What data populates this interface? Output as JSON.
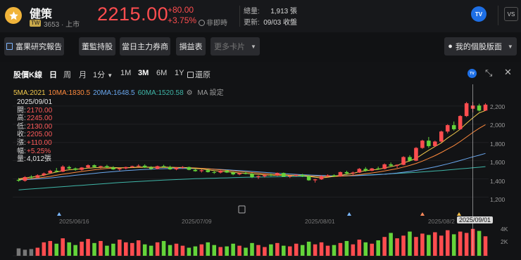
{
  "header": {
    "name": "健策",
    "market_tag": "TW",
    "code": "3653 · 上市",
    "price": "2215.00",
    "change": "+80.00",
    "change_pct": "+3.75%",
    "status": "非即時",
    "volume_label": "總量:",
    "volume_value": "1,913 張",
    "updated_label": "更新:",
    "updated_value": "09/03 收盤",
    "tv_label": "TV",
    "vs_label": "VS"
  },
  "toolbar": {
    "research": "富果研究報告",
    "directors": "董監持股",
    "brokers": "當日主力券商",
    "financials": "損益表",
    "more_cards": "更多卡片",
    "layout": "我的個股版面"
  },
  "chart_controls": {
    "title": "股價K線",
    "periods": [
      "日",
      "周",
      "月",
      "1分"
    ],
    "ranges": [
      "1M",
      "3M",
      "6M",
      "1Y"
    ],
    "active_range": "3M",
    "restore": "還原"
  },
  "ma_legend": {
    "ma5": "5MA:2021",
    "ma10": "10MA:1830.5",
    "ma20": "20MA:1648.5",
    "ma60": "60MA:1520.58",
    "settings": "MA 設定"
  },
  "ohlc": {
    "date": "2025/09/01",
    "open_label": "開:",
    "open": "2170.00",
    "high_label": "高:",
    "high": "2245.00",
    "low_label": "低:",
    "low": "2130.00",
    "close_label": "收:",
    "close": "2205.00",
    "chg_label": "漲:",
    "chg": "+110.00",
    "pct_label": "幅:",
    "pct": "+5.25%",
    "vol_label": "量:",
    "vol": "4,012張"
  },
  "colors": {
    "up": "#ff4d4f",
    "down": "#64d43a",
    "ma5": "#f2c94c",
    "ma10": "#ff8a3d",
    "ma20": "#6aa8f0",
    "ma60": "#3fb6a8"
  },
  "chart_data": {
    "type": "candlestick",
    "y_ticks": [
      "2,200",
      "2,000",
      "1,800",
      "1,600",
      "1,400",
      "1,200"
    ],
    "y_tick_values": [
      2200,
      2000,
      1800,
      1600,
      1400,
      1200
    ],
    "x_ticks": [
      "2025/06/16",
      "2025/07/09",
      "2025/08/01",
      "2025/08/2"
    ],
    "crosshair_date": "2025/09/01",
    "volume_ticks": [
      "4K",
      "2K"
    ],
    "ylim": [
      1050,
      2330
    ],
    "candles": [
      [
        1390,
        1410,
        1370,
        1380
      ],
      [
        1380,
        1430,
        1370,
        1420
      ],
      [
        1425,
        1440,
        1400,
        1415
      ],
      [
        1415,
        1450,
        1410,
        1440
      ],
      [
        1440,
        1470,
        1430,
        1460
      ],
      [
        1465,
        1500,
        1455,
        1490
      ],
      [
        1490,
        1520,
        1470,
        1480
      ],
      [
        1480,
        1550,
        1475,
        1535
      ],
      [
        1530,
        1545,
        1505,
        1515
      ],
      [
        1515,
        1525,
        1490,
        1500
      ],
      [
        1500,
        1530,
        1490,
        1525
      ],
      [
        1525,
        1560,
        1515,
        1550
      ],
      [
        1550,
        1560,
        1520,
        1530
      ],
      [
        1530,
        1545,
        1515,
        1540
      ],
      [
        1540,
        1555,
        1520,
        1525
      ],
      [
        1525,
        1540,
        1500,
        1505
      ],
      [
        1505,
        1520,
        1490,
        1515
      ],
      [
        1515,
        1535,
        1505,
        1530
      ],
      [
        1530,
        1545,
        1520,
        1540
      ],
      [
        1540,
        1560,
        1530,
        1545
      ],
      [
        1545,
        1560,
        1520,
        1525
      ],
      [
        1525,
        1540,
        1500,
        1510
      ],
      [
        1510,
        1545,
        1505,
        1540
      ],
      [
        1540,
        1555,
        1525,
        1530
      ],
      [
        1530,
        1545,
        1500,
        1505
      ],
      [
        1505,
        1530,
        1495,
        1525
      ],
      [
        1525,
        1540,
        1510,
        1530
      ],
      [
        1530,
        1535,
        1495,
        1500
      ],
      [
        1500,
        1515,
        1480,
        1485
      ],
      [
        1485,
        1505,
        1470,
        1495
      ],
      [
        1495,
        1510,
        1470,
        1475
      ],
      [
        1475,
        1490,
        1455,
        1470
      ],
      [
        1470,
        1495,
        1460,
        1490
      ],
      [
        1490,
        1500,
        1465,
        1470
      ],
      [
        1470,
        1480,
        1440,
        1450
      ],
      [
        1450,
        1470,
        1440,
        1465
      ],
      [
        1465,
        1480,
        1450,
        1455
      ],
      [
        1455,
        1465,
        1410,
        1420
      ],
      [
        1420,
        1440,
        1400,
        1430
      ],
      [
        1430,
        1450,
        1415,
        1445
      ],
      [
        1445,
        1460,
        1430,
        1440
      ],
      [
        1440,
        1470,
        1430,
        1465
      ],
      [
        1465,
        1470,
        1420,
        1425
      ],
      [
        1425,
        1440,
        1410,
        1435
      ],
      [
        1435,
        1450,
        1425,
        1445
      ],
      [
        1445,
        1455,
        1420,
        1430
      ],
      [
        1430,
        1440,
        1380,
        1385
      ],
      [
        1385,
        1400,
        1360,
        1395
      ],
      [
        1395,
        1440,
        1390,
        1430
      ],
      [
        1430,
        1450,
        1420,
        1440
      ],
      [
        1440,
        1450,
        1420,
        1430
      ],
      [
        1430,
        1480,
        1425,
        1475
      ],
      [
        1475,
        1490,
        1450,
        1460
      ],
      [
        1460,
        1480,
        1440,
        1470
      ],
      [
        1470,
        1520,
        1465,
        1510
      ],
      [
        1510,
        1530,
        1480,
        1490
      ],
      [
        1490,
        1520,
        1485,
        1515
      ],
      [
        1515,
        1535,
        1500,
        1510
      ],
      [
        1510,
        1570,
        1505,
        1560
      ],
      [
        1560,
        1580,
        1535,
        1545
      ],
      [
        1545,
        1560,
        1520,
        1555
      ],
      [
        1555,
        1650,
        1550,
        1640
      ],
      [
        1640,
        1660,
        1590,
        1600
      ],
      [
        1600,
        1750,
        1595,
        1740
      ],
      [
        1740,
        1830,
        1730,
        1820
      ],
      [
        1820,
        1860,
        1740,
        1760
      ],
      [
        1760,
        1820,
        1755,
        1810
      ],
      [
        1810,
        1930,
        1800,
        1920
      ],
      [
        1920,
        2000,
        1900,
        1990
      ],
      [
        1990,
        2030,
        1930,
        1945
      ],
      [
        1945,
        2100,
        1940,
        2090
      ],
      [
        2090,
        2245,
        2080,
        2230
      ],
      [
        2170,
        2245,
        2130,
        2205
      ],
      [
        2205,
        2225,
        2140,
        2150
      ],
      [
        2150,
        2230,
        2145,
        2215
      ]
    ],
    "volumes": [
      1.1,
      0.9,
      1.0,
      1.2,
      2.0,
      2.2,
      1.8,
      2.6,
      2.0,
      1.6,
      2.1,
      2.5,
      1.9,
      2.2,
      1.5,
      1.8,
      2.4,
      2.0,
      1.9,
      2.3,
      1.7,
      1.5,
      2.0,
      2.2,
      1.6,
      1.8,
      1.5,
      1.2,
      1.4,
      1.7,
      2.0,
      1.6,
      1.3,
      1.4,
      1.8,
      1.5,
      1.2,
      1.9,
      1.6,
      1.3,
      1.7,
      1.9,
      1.5,
      1.4,
      1.8,
      1.6,
      2.1,
      1.7,
      2.0,
      1.5,
      1.6,
      1.9,
      2.2,
      1.7,
      2.4,
      2.0,
      1.8,
      2.3,
      2.8,
      3.4,
      2.6,
      3.0,
      3.6,
      2.8,
      3.3,
      3.1,
      3.5,
      3.0,
      3.8,
      3.2,
      3.6,
      3.4,
      4.0,
      3.7,
      2.9
    ],
    "ma5": [
      1400,
      1410,
      1420,
      1430,
      1440,
      1460,
      1475,
      1490,
      1500,
      1505,
      1510,
      1518,
      1522,
      1526,
      1528,
      1525,
      1522,
      1522,
      1525,
      1530,
      1530,
      1528,
      1527,
      1530,
      1528,
      1525,
      1525,
      1522,
      1515,
      1510,
      1500,
      1490,
      1485,
      1480,
      1472,
      1466,
      1462,
      1455,
      1450,
      1445,
      1440,
      1440,
      1440,
      1438,
      1438,
      1438,
      1428,
      1418,
      1412,
      1418,
      1428,
      1440,
      1450,
      1462,
      1478,
      1490,
      1498,
      1505,
      1520,
      1535,
      1548,
      1575,
      1598,
      1625,
      1670,
      1715,
      1755,
      1795,
      1850,
      1895,
      1945,
      2010,
      2070,
      2125,
      2150
    ],
    "ma10": [
      1395,
      1400,
      1405,
      1410,
      1418,
      1428,
      1440,
      1452,
      1462,
      1472,
      1482,
      1492,
      1500,
      1508,
      1514,
      1518,
      1520,
      1522,
      1524,
      1526,
      1527,
      1527,
      1526,
      1526,
      1526,
      1525,
      1524,
      1523,
      1520,
      1516,
      1512,
      1506,
      1500,
      1494,
      1488,
      1482,
      1476,
      1470,
      1464,
      1458,
      1452,
      1448,
      1445,
      1442,
      1440,
      1438,
      1434,
      1430,
      1427,
      1426,
      1427,
      1430,
      1434,
      1440,
      1447,
      1456,
      1466,
      1476,
      1487,
      1500,
      1513,
      1530,
      1548,
      1570,
      1595,
      1625,
      1655,
      1690,
      1728,
      1765,
      1810,
      1860,
      1910,
      1955,
      1995
    ],
    "ma20": [
      1390,
      1393,
      1396,
      1400,
      1405,
      1411,
      1418,
      1425,
      1432,
      1440,
      1447,
      1454,
      1461,
      1468,
      1474,
      1480,
      1486,
      1491,
      1496,
      1500,
      1504,
      1507,
      1510,
      1512,
      1514,
      1515,
      1515,
      1515,
      1514,
      1512,
      1510,
      1507,
      1504,
      1500,
      1496,
      1492,
      1487,
      1482,
      1477,
      1472,
      1467,
      1462,
      1458,
      1454,
      1450,
      1446,
      1443,
      1440,
      1437,
      1435,
      1433,
      1433,
      1434,
      1435,
      1437,
      1440,
      1443,
      1447,
      1452,
      1458,
      1465,
      1473,
      1482,
      1493,
      1505,
      1518,
      1532,
      1548,
      1565,
      1583,
      1602,
      1622,
      1642,
      1660,
      1680
    ],
    "ma60": [
      1280,
      1285,
      1290,
      1295,
      1300,
      1305,
      1310,
      1315,
      1320,
      1325,
      1330,
      1335,
      1340,
      1345,
      1350,
      1355,
      1360,
      1364,
      1368,
      1372,
      1376,
      1380,
      1384,
      1387,
      1390,
      1393,
      1396,
      1399,
      1402,
      1404,
      1406,
      1408,
      1410,
      1412,
      1414,
      1416,
      1418,
      1419,
      1420,
      1421,
      1422,
      1423,
      1424,
      1425,
      1426,
      1427,
      1428,
      1429,
      1430,
      1431,
      1432,
      1434,
      1436,
      1438,
      1440,
      1443,
      1446,
      1449,
      1452,
      1456,
      1460,
      1464,
      1468,
      1472,
      1477,
      1482,
      1487,
      1492,
      1498,
      1504,
      1510,
      1516,
      1522,
      1528,
      1535
    ]
  }
}
